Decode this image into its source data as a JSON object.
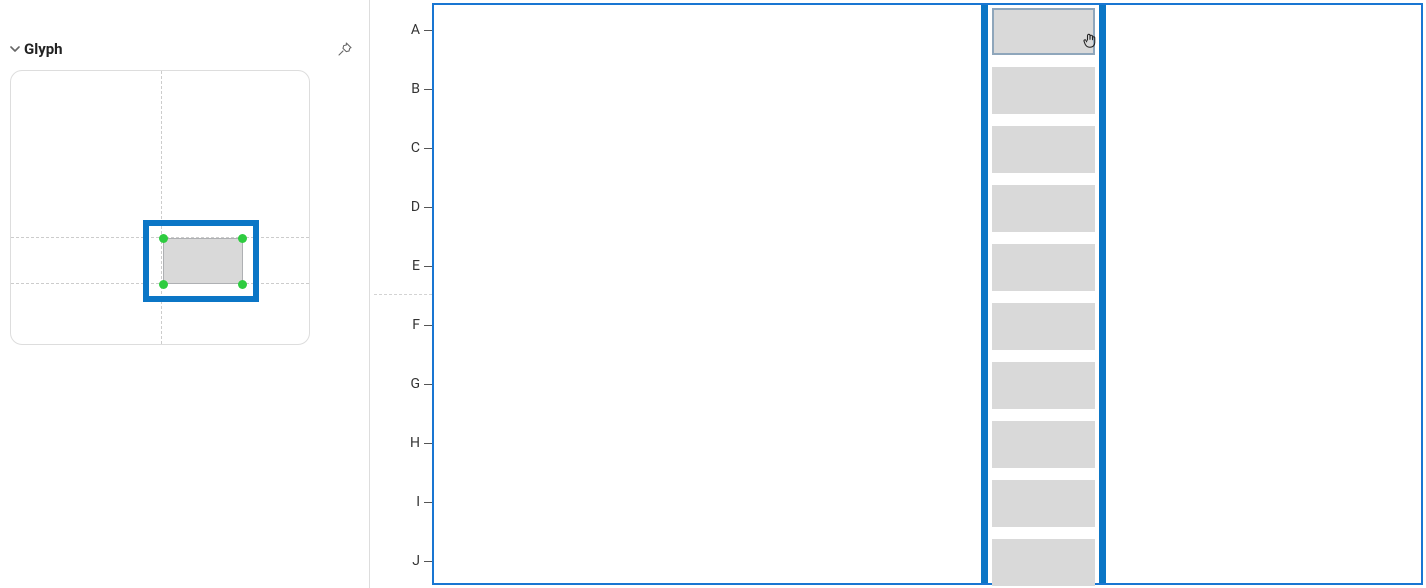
{
  "sidebar": {
    "panel_title": "Glyph"
  },
  "canvas": {
    "row_labels": [
      "A",
      "B",
      "C",
      "D",
      "E",
      "F",
      "G",
      "H",
      "I",
      "J"
    ]
  }
}
